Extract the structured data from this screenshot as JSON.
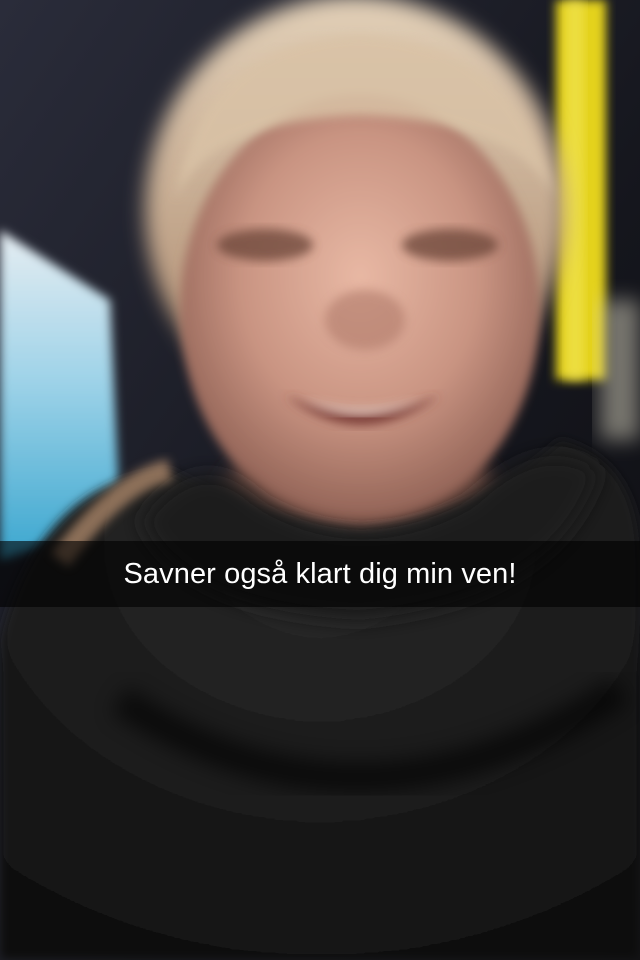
{
  "snap": {
    "caption": "Savner også klart dig min ven!",
    "caption_bar_color": "#000000",
    "caption_text_color": "#ffffff"
  },
  "photo": {
    "subject": "selfie-person-smiling",
    "palette": {
      "background_dark": "#1a1b22",
      "sky_blue": "#4fb6d8",
      "window_white": "#dfe6ec",
      "pole_yellow": "#e4d21a",
      "skin": "#c99482",
      "hair": "#c8a98a",
      "sweater": "#161616"
    }
  }
}
